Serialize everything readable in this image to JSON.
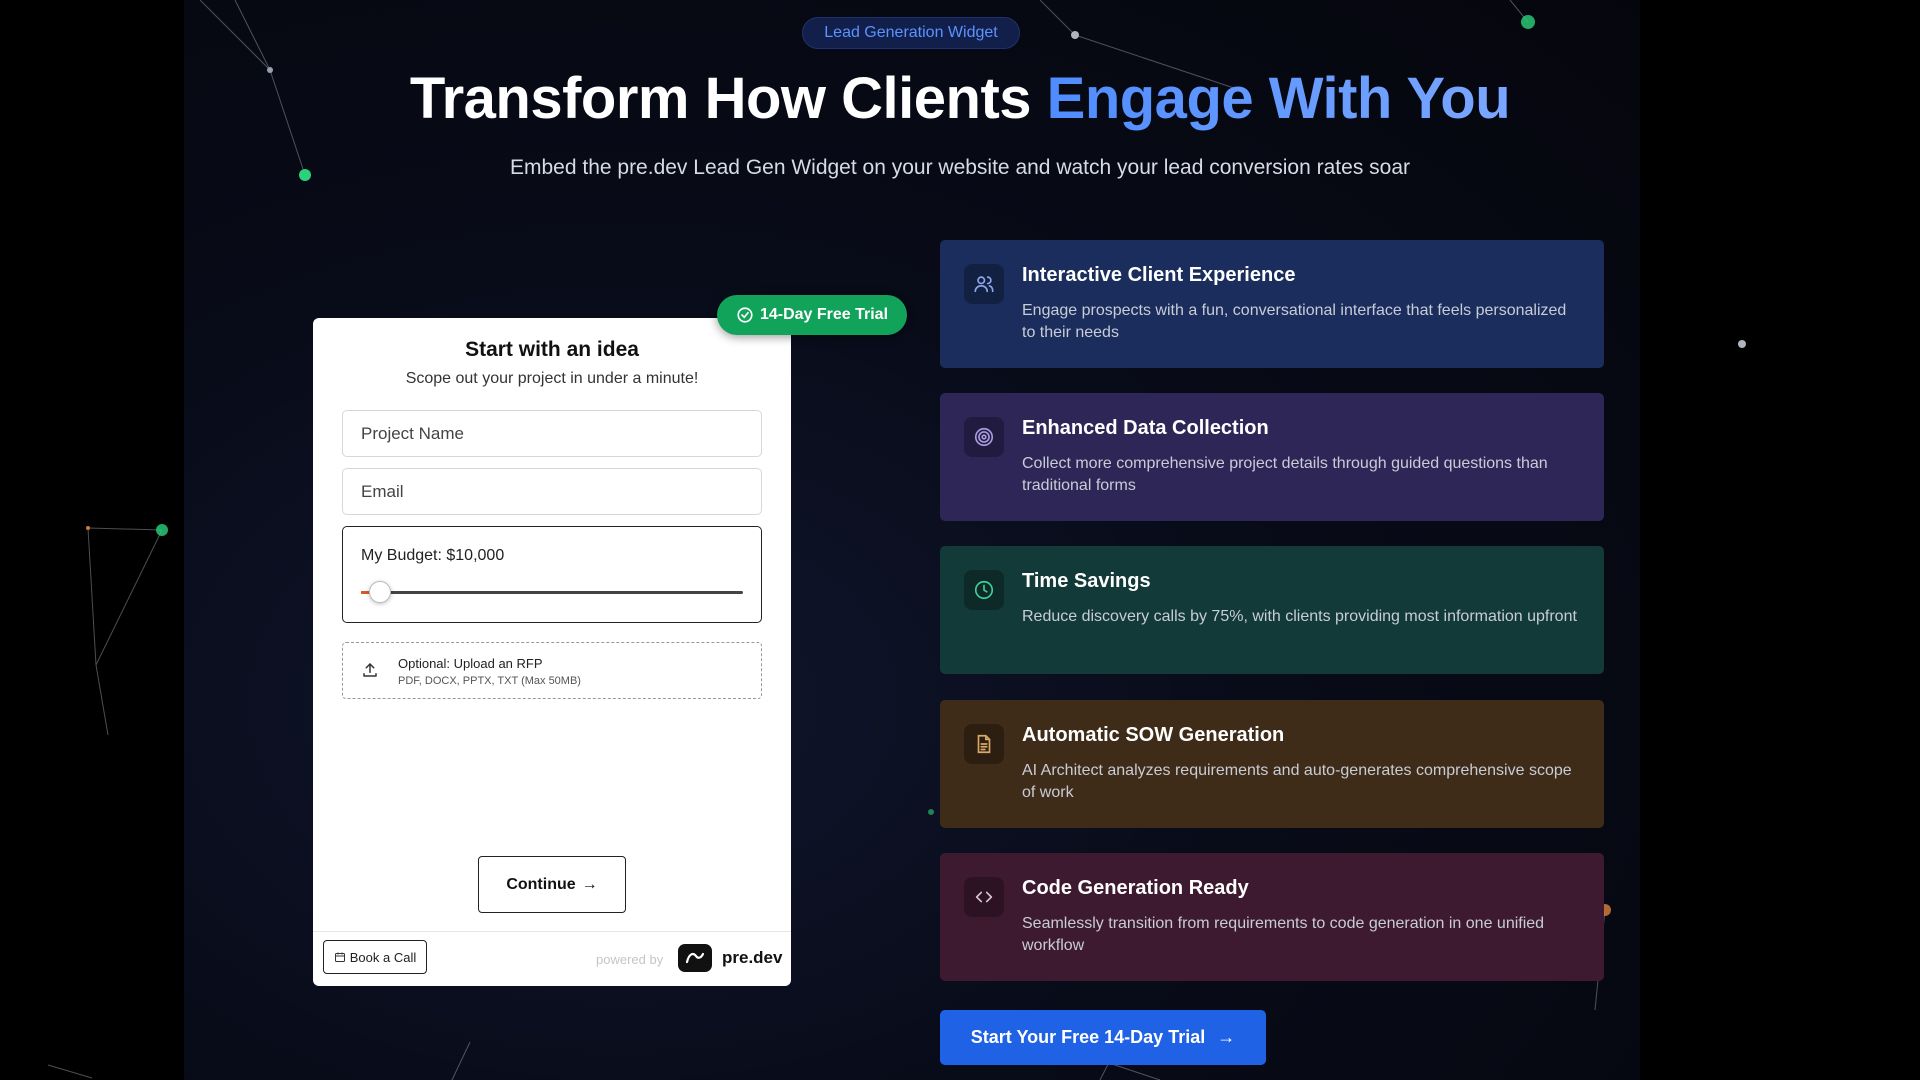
{
  "header": {
    "tag": "Lead Generation Widget",
    "headline_part1": "Transform How Clients ",
    "headline_part2": "Engage With You",
    "subheadline": "Embed the pre.dev Lead Gen Widget on your website and watch your lead conversion rates soar"
  },
  "widget": {
    "trial_badge": "14-Day Free Trial",
    "title": "Start with an idea",
    "subtitle": "Scope out your project in under a minute!",
    "project_name_placeholder": "Project Name",
    "email_placeholder": "Email",
    "budget_label": "My Budget: $10,000",
    "budget_fraction": 0.05,
    "upload_title": "Optional: Upload an RFP",
    "upload_hint": "PDF, DOCX, PPTX, TXT (Max 50MB)",
    "continue_label": "Continue",
    "book_call_label": "Book a Call",
    "powered_by": "powered by",
    "brand": "pre.dev"
  },
  "features": [
    {
      "icon": "users-icon",
      "title": "Interactive Client Experience",
      "description": "Engage prospects with a fun, conversational interface that feels personalized to their needs",
      "color": "#1a2d5c"
    },
    {
      "icon": "target-icon",
      "title": "Enhanced Data Collection",
      "description": "Collect more comprehensive project details through guided questions than traditional forms",
      "color": "#2f2658"
    },
    {
      "icon": "clock-icon",
      "title": "Time Savings",
      "description": "Reduce discovery calls by 75%, with clients providing most information upfront",
      "color": "#123a38"
    },
    {
      "icon": "document-icon",
      "title": "Automatic SOW Generation",
      "description": "AI Architect analyzes requirements and auto-generates comprehensive scope of work",
      "color": "#3e2c18"
    },
    {
      "icon": "code-icon",
      "title": "Code Generation Ready",
      "description": "Seamlessly transition from requirements to code generation in one unified workflow",
      "color": "#3e1a30"
    }
  ],
  "cta": {
    "label": "Start Your Free 14-Day Trial"
  },
  "colors": {
    "accent_blue": "#1f62e6",
    "trial_green": "#12a35a",
    "headline_gradient": "#4f8cff"
  }
}
